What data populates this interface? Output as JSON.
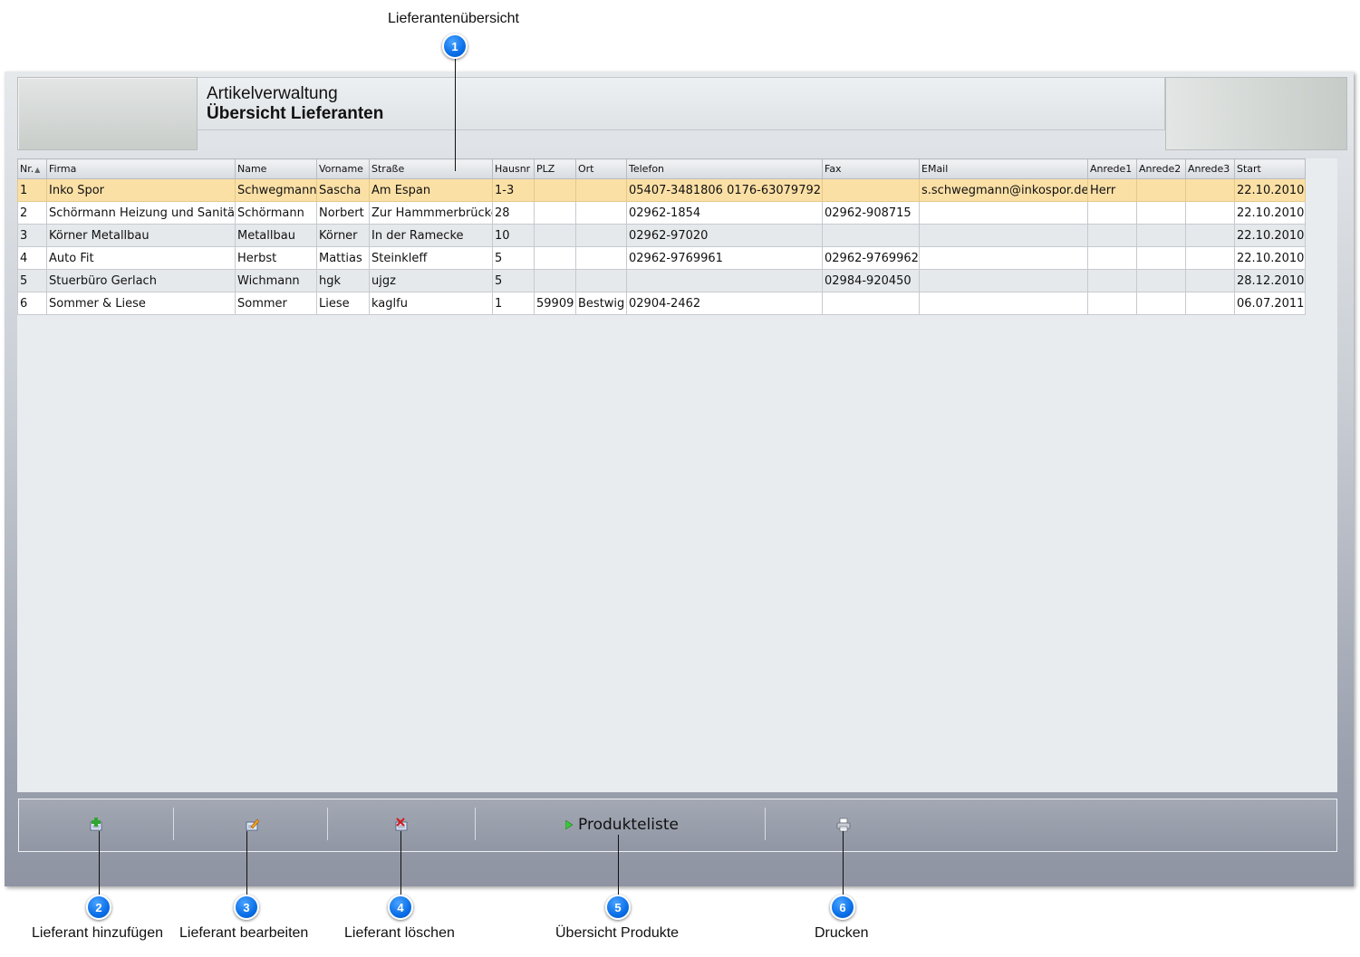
{
  "annotations": {
    "top_label": "Lieferantenübersicht",
    "badges": [
      "1",
      "2",
      "3",
      "4",
      "5",
      "6"
    ],
    "bottom_labels": [
      "Lieferant hinzufügen",
      "Lieferant bearbeiten",
      "Lieferant löschen",
      "Übersicht Produkte",
      "Drucken"
    ]
  },
  "header": {
    "subtitle": "Artikelverwaltung",
    "title": "Übersicht Lieferanten"
  },
  "table": {
    "columns": [
      "Nr.",
      "Firma",
      "Name",
      "Vorname",
      "Straße",
      "Hausnr",
      "PLZ",
      "Ort",
      "Telefon",
      "Fax",
      "EMail",
      "Anrede1",
      "Anrede2",
      "Anrede3",
      "Start"
    ],
    "sort_indicator": "▲",
    "rows": [
      [
        "1",
        "Inko Spor",
        "Schwegmann",
        "Sascha",
        "Am Espan",
        "1-3",
        "",
        "",
        "05407-3481806  0176-63079792",
        "",
        "s.schwegmann@inkospor.de",
        "Herr",
        "",
        "",
        "22.10.2010"
      ],
      [
        "2",
        "Schörmann Heizung und Sanitär",
        "Schörmann",
        "Norbert",
        "Zur Hammmerbrücke",
        "28",
        "",
        "",
        "02962-1854",
        "02962-908715",
        "",
        "",
        "",
        "",
        "22.10.2010"
      ],
      [
        "3",
        "Körner Metallbau",
        "Metallbau",
        "Körner",
        "In der Ramecke",
        "10",
        "",
        "",
        "02962-97020",
        "",
        "",
        "",
        "",
        "",
        "22.10.2010"
      ],
      [
        "4",
        "Auto Fit",
        "Herbst",
        "Mattias",
        "Steinkleff",
        "5",
        "",
        "",
        "02962-9769961",
        "02962-9769962",
        "",
        "",
        "",
        "",
        "22.10.2010"
      ],
      [
        "5",
        "Stuerbüro Gerlach",
        "Wichmann",
        "hgk",
        "ujgz",
        "5",
        "",
        "",
        "",
        "02984-920450",
        "",
        "",
        "",
        "",
        "28.12.2010"
      ],
      [
        "6",
        "Sommer & Liese",
        "Sommer",
        "Liese",
        "kaglfu",
        "1",
        "59909",
        "Bestwig",
        "02904-2462",
        "",
        "",
        "",
        "",
        "",
        "06.07.2011"
      ]
    ]
  },
  "toolbar": {
    "products_label": "Produkteliste",
    "icons": [
      "add-supplier-icon",
      "edit-supplier-icon",
      "delete-supplier-icon",
      "play-arrow-icon",
      "printer-icon"
    ]
  },
  "colors": {
    "selected_row": "#fbe0a6",
    "badge_blue": "#0a6fe8"
  }
}
